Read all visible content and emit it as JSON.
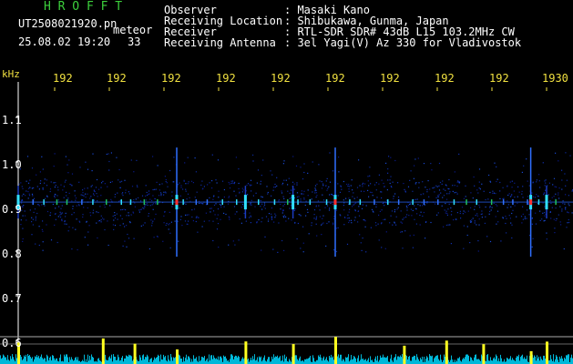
{
  "header": {
    "app_name": "H R O F F T",
    "filename": "UT2508021920.pn",
    "meteor_label": "meteor",
    "datetime": "25.08.02 19:20",
    "count": "33"
  },
  "info": {
    "labels": [
      "Observer",
      "Receiving Location",
      "Receiver",
      "Receiving Antenna"
    ],
    "values": [
      ": Masaki Kano",
      ": Shibukawa, Gunma, Japan",
      ": RTL-SDR SDR# 43dB L15 103.2MHz CW",
      ": 3el Yagi(V) Az 330 for Vladivostok"
    ]
  },
  "axis": {
    "unit": "kHz",
    "y_ticks": [
      "1.1",
      "1.0",
      "0.9",
      "0.8",
      "0.7",
      "0.6"
    ],
    "x_ticks": [
      "192",
      "192",
      "192",
      "192",
      "192",
      "192",
      "192",
      "192",
      "192",
      "1930"
    ]
  },
  "chart_data": {
    "type": "heatmap",
    "y_unit": "kHz",
    "yticks": [
      1.1,
      1.0,
      0.9,
      0.8,
      0.7,
      0.6
    ],
    "ylim": [
      0.6,
      1.1
    ],
    "carrier_khz": 0.91,
    "meteor_echo_minutes_past": [
      0.0,
      3.0,
      4.3,
      5.2,
      6.0,
      9.7,
      10.0,
      10.8
    ],
    "strong_echo_minutes_past": [
      3.0,
      6.0,
      9.7
    ]
  },
  "colors": {
    "background": "#000000",
    "title": "#3ccf3c",
    "text": "#ffffff",
    "ticks": "#f0e040",
    "spectrum": "#00e5ff",
    "peak": "#ffff00"
  }
}
